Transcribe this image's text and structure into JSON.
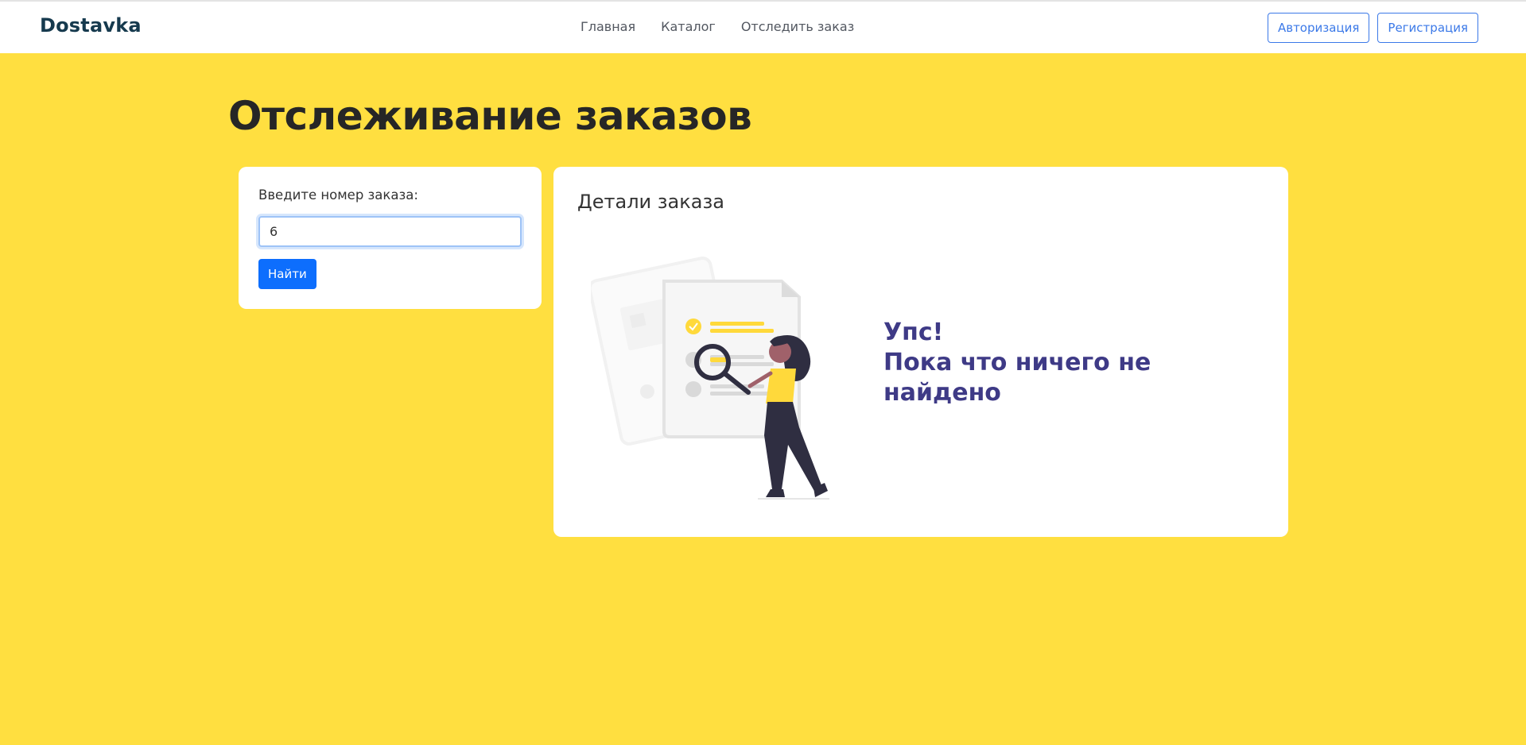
{
  "header": {
    "brand": "Dostavka",
    "nav": {
      "home": "Главная",
      "catalog": "Каталог",
      "track": "Отследить заказ"
    },
    "auth": {
      "login": "Авторизация",
      "register": "Регистрация"
    }
  },
  "page": {
    "title": "Отслеживание заказов"
  },
  "search": {
    "label": "Введите номер заказа:",
    "value": "6",
    "button": "Найти"
  },
  "details": {
    "title": "Детали заказа",
    "empty_line1": "Упс!",
    "empty_line2": "Пока что ничего не",
    "empty_line3": "найдено",
    "illustration_icon": "woman-with-magnifier-searching-documents-icon"
  },
  "colors": {
    "background": "#ffdf40",
    "brand": "#163a4e",
    "accent": "#0d6efd",
    "message": "#3e3a86"
  }
}
